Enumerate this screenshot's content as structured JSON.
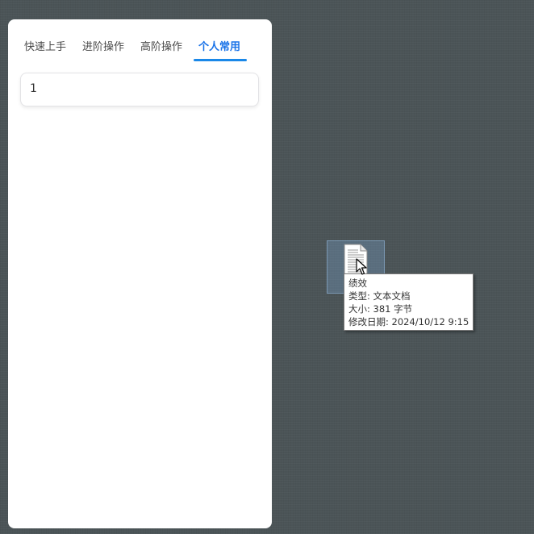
{
  "panel": {
    "tabs": [
      {
        "label": "快速上手",
        "active": false
      },
      {
        "label": "进阶操作",
        "active": false
      },
      {
        "label": "高阶操作",
        "active": false
      },
      {
        "label": "个人常用",
        "active": true
      }
    ],
    "card": {
      "value": "1"
    }
  },
  "desktop": {
    "file_icon": "text-document-icon",
    "tooltip": {
      "name": "绩效",
      "type_line": "类型: 文本文档",
      "size_line": "大小: 381 字节",
      "modified_line": "修改日期: 2024/10/12 9:15"
    }
  },
  "colors": {
    "accent": "#1a88e8",
    "desktop_bg": "#4b5457"
  }
}
